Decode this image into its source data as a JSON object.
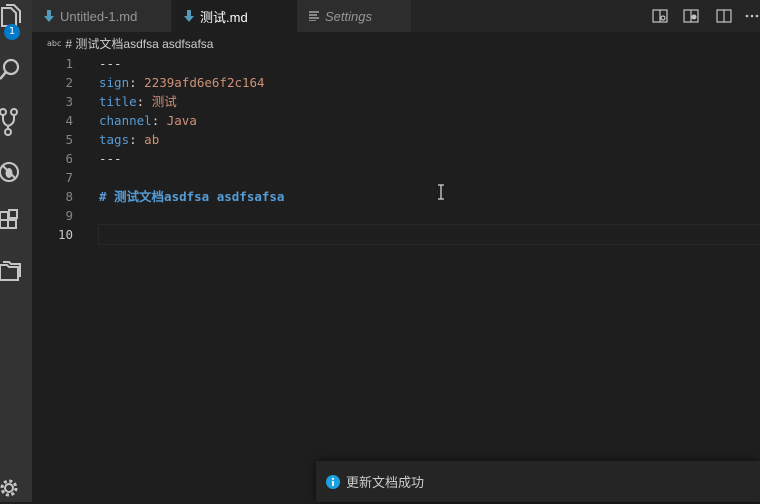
{
  "activity_bar": {
    "explorer_badge": "1"
  },
  "tabs": [
    {
      "label": "Untitled-1.md",
      "active": false,
      "icon": "markdown-icon"
    },
    {
      "label": "测试.md",
      "active": true,
      "dirty": true,
      "icon": "markdown-icon"
    },
    {
      "label": "Settings",
      "active": false,
      "italic": true,
      "icon": "settings-list-icon"
    }
  ],
  "breadcrumb": {
    "symbol": "abc",
    "text": "# 测试文档asdfsa asdfsafsa"
  },
  "editor": {
    "lines": [
      {
        "n": "1",
        "parts": [
          {
            "t": "---",
            "c": "k-dash"
          }
        ]
      },
      {
        "n": "2",
        "parts": [
          {
            "t": "sign",
            "c": "k-yaml"
          },
          {
            "t": ": ",
            "c": "k-dash"
          },
          {
            "t": "2239afd6e6f2c164",
            "c": "k-val"
          }
        ]
      },
      {
        "n": "3",
        "parts": [
          {
            "t": "title",
            "c": "k-yaml"
          },
          {
            "t": ": ",
            "c": "k-dash"
          },
          {
            "t": "测试",
            "c": "k-val"
          }
        ]
      },
      {
        "n": "4",
        "parts": [
          {
            "t": "channel",
            "c": "k-yaml"
          },
          {
            "t": ": ",
            "c": "k-dash"
          },
          {
            "t": "Java",
            "c": "k-val"
          }
        ]
      },
      {
        "n": "5",
        "parts": [
          {
            "t": "tags",
            "c": "k-yaml"
          },
          {
            "t": ": ",
            "c": "k-dash"
          },
          {
            "t": "ab",
            "c": "k-val"
          }
        ]
      },
      {
        "n": "6",
        "parts": [
          {
            "t": "---",
            "c": "k-dash"
          }
        ]
      },
      {
        "n": "7",
        "parts": []
      },
      {
        "n": "8",
        "parts": [
          {
            "t": "# 测试文档asdfsa asdfsafsa",
            "c": "k-head"
          }
        ]
      },
      {
        "n": "9",
        "parts": []
      },
      {
        "n": "10",
        "parts": [],
        "current": true
      }
    ]
  },
  "notification": {
    "text": "更新文档成功"
  },
  "colors": {
    "accent": "#007acc",
    "yaml_key": "#569cd6",
    "yaml_value": "#ce9178"
  }
}
